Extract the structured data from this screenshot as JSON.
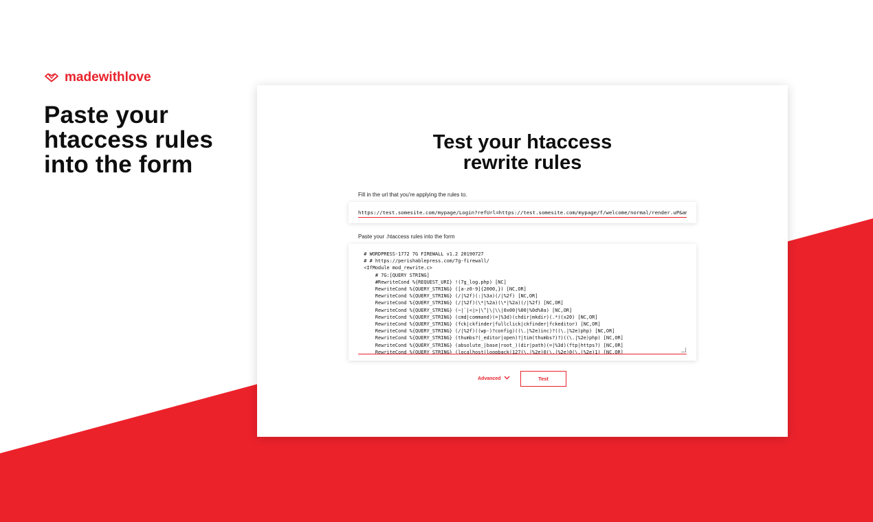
{
  "brand": {
    "name": "madewithlove",
    "color": "#e8222b"
  },
  "hero": {
    "title": "Paste your\nhtaccess rules\ninto the form"
  },
  "card": {
    "title": "Test your htaccess\nrewrite rules",
    "url_label": "Fill in the url that you're applying the rules to.",
    "url_value": "https://test.somesite.com/mypage/Login?refUrl=https://test.somesite.com/mypage/f/welcome/normal/render.uP&am",
    "rules_label": "Paste your .htaccess rules into the form",
    "rules_lines": [
      "  # WORDPRESS-1772 7G FIREWALL v1.2 20190727",
      "  # # https://perishablepress.com/7g-firewall/",
      "  <IfModule mod_rewrite.c>",
      "      # 7G:[QUERY STRING]",
      "      #RewriteCond %{REQUEST_URI} !(7g_log.php) [NC]",
      "      RewriteCond %{QUERY_STRING} ([a-z0-9]{2000,}) [NC,OR]",
      "      RewriteCond %{QUERY_STRING} (/|%2f)(:|%3a)(/|%2f) [NC,OR]",
      "      RewriteCond %{QUERY_STRING} (/|%2f)(\\*|%2a)(\\*|%2a)(/|%2f) [NC,OR]",
      "      RewriteCond %{QUERY_STRING} (~|`|<|>|\\^|\\|\\\\|0x00|%00|%0d%0a) [NC,OR]",
      "      RewriteCond %{QUERY_STRING} (cmd|command)(=|%3d)(chdir|mkdir)(.*)(x20) [NC,OR]",
      "      RewriteCond %{QUERY_STRING} (fck|ckfinder|fullclick|ckfinder|fckeditor) [NC,OR]",
      "      RewriteCond %{QUERY_STRING} (/|%2f)((wp-)?config)((\\.|%2e)inc)?((\\.|%2e)php) [NC,OR]",
      "      RewriteCond %{QUERY_STRING} (thumbs?(_editor|open)?|tim(thumbs?)?)((\\.|%2e)php) [NC,OR]",
      "      RewriteCond %{QUERY_STRING} (absolute_|base|root_)(dir|path)(=|%3d)(ftp|https?) [NC,OR]",
      "      RewriteCond %{QUERY_STRING} (localhost|loopback|127(\\.|%2e)0(\\.|%2e)0(\\.|%2e)1) [NC,OR]"
    ],
    "advanced_label": "Advanced",
    "advanced_icon": "chevron-down-icon",
    "test_label": "Test"
  }
}
